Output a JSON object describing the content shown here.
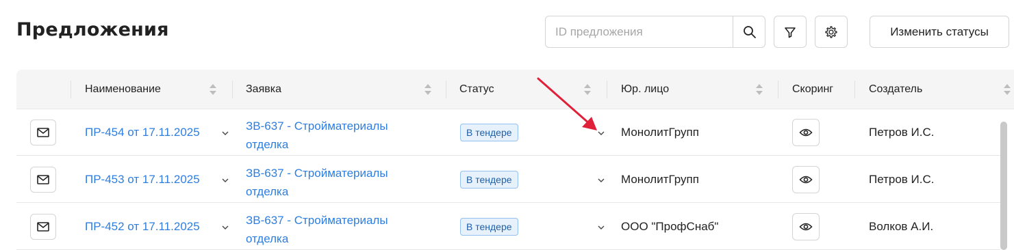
{
  "page": {
    "title": "Предложения"
  },
  "search": {
    "placeholder": "ID предложения"
  },
  "toolbar": {
    "change_status_label": "Изменить статусы"
  },
  "table": {
    "columns": [
      {
        "key": "name",
        "label": "Наименование"
      },
      {
        "key": "request",
        "label": "Заявка"
      },
      {
        "key": "status",
        "label": "Статус"
      },
      {
        "key": "legal",
        "label": "Юр. лицо"
      },
      {
        "key": "scoring",
        "label": "Скоринг"
      },
      {
        "key": "creator",
        "label": "Создатель"
      }
    ],
    "rows": [
      {
        "name": "ПР-454 от 17.11.2025",
        "request_line1": "ЗВ-637 - Стройматериалы",
        "request_line2": "отделка",
        "status": "В тендере",
        "legal": "МонолитГрупп",
        "creator": "Петров И.С."
      },
      {
        "name": "ПР-453 от 17.11.2025",
        "request_line1": "ЗВ-637 - Стройматериалы",
        "request_line2": "отделка",
        "status": "В тендере",
        "legal": "МонолитГрупп",
        "creator": "Петров И.С."
      },
      {
        "name": "ПР-452 от 17.11.2025",
        "request_line1": "ЗВ-637 - Стройматериалы",
        "request_line2": "отделка",
        "status": "В тендере",
        "legal": "ООО \"ПрофСнаб\"",
        "creator": "Волков А.И."
      }
    ]
  },
  "icons": {
    "search": "search-icon",
    "filter": "filter-icon",
    "settings": "gear-icon",
    "mail": "mail-icon",
    "eye": "eye-icon",
    "chevron": "chevron-down-icon",
    "sort": "sort-icon"
  },
  "colors": {
    "link": "#2d7ee0",
    "badge_bg": "#e7f1fc",
    "badge_border": "#93c0f0",
    "annotation_arrow": "#e0203a"
  }
}
